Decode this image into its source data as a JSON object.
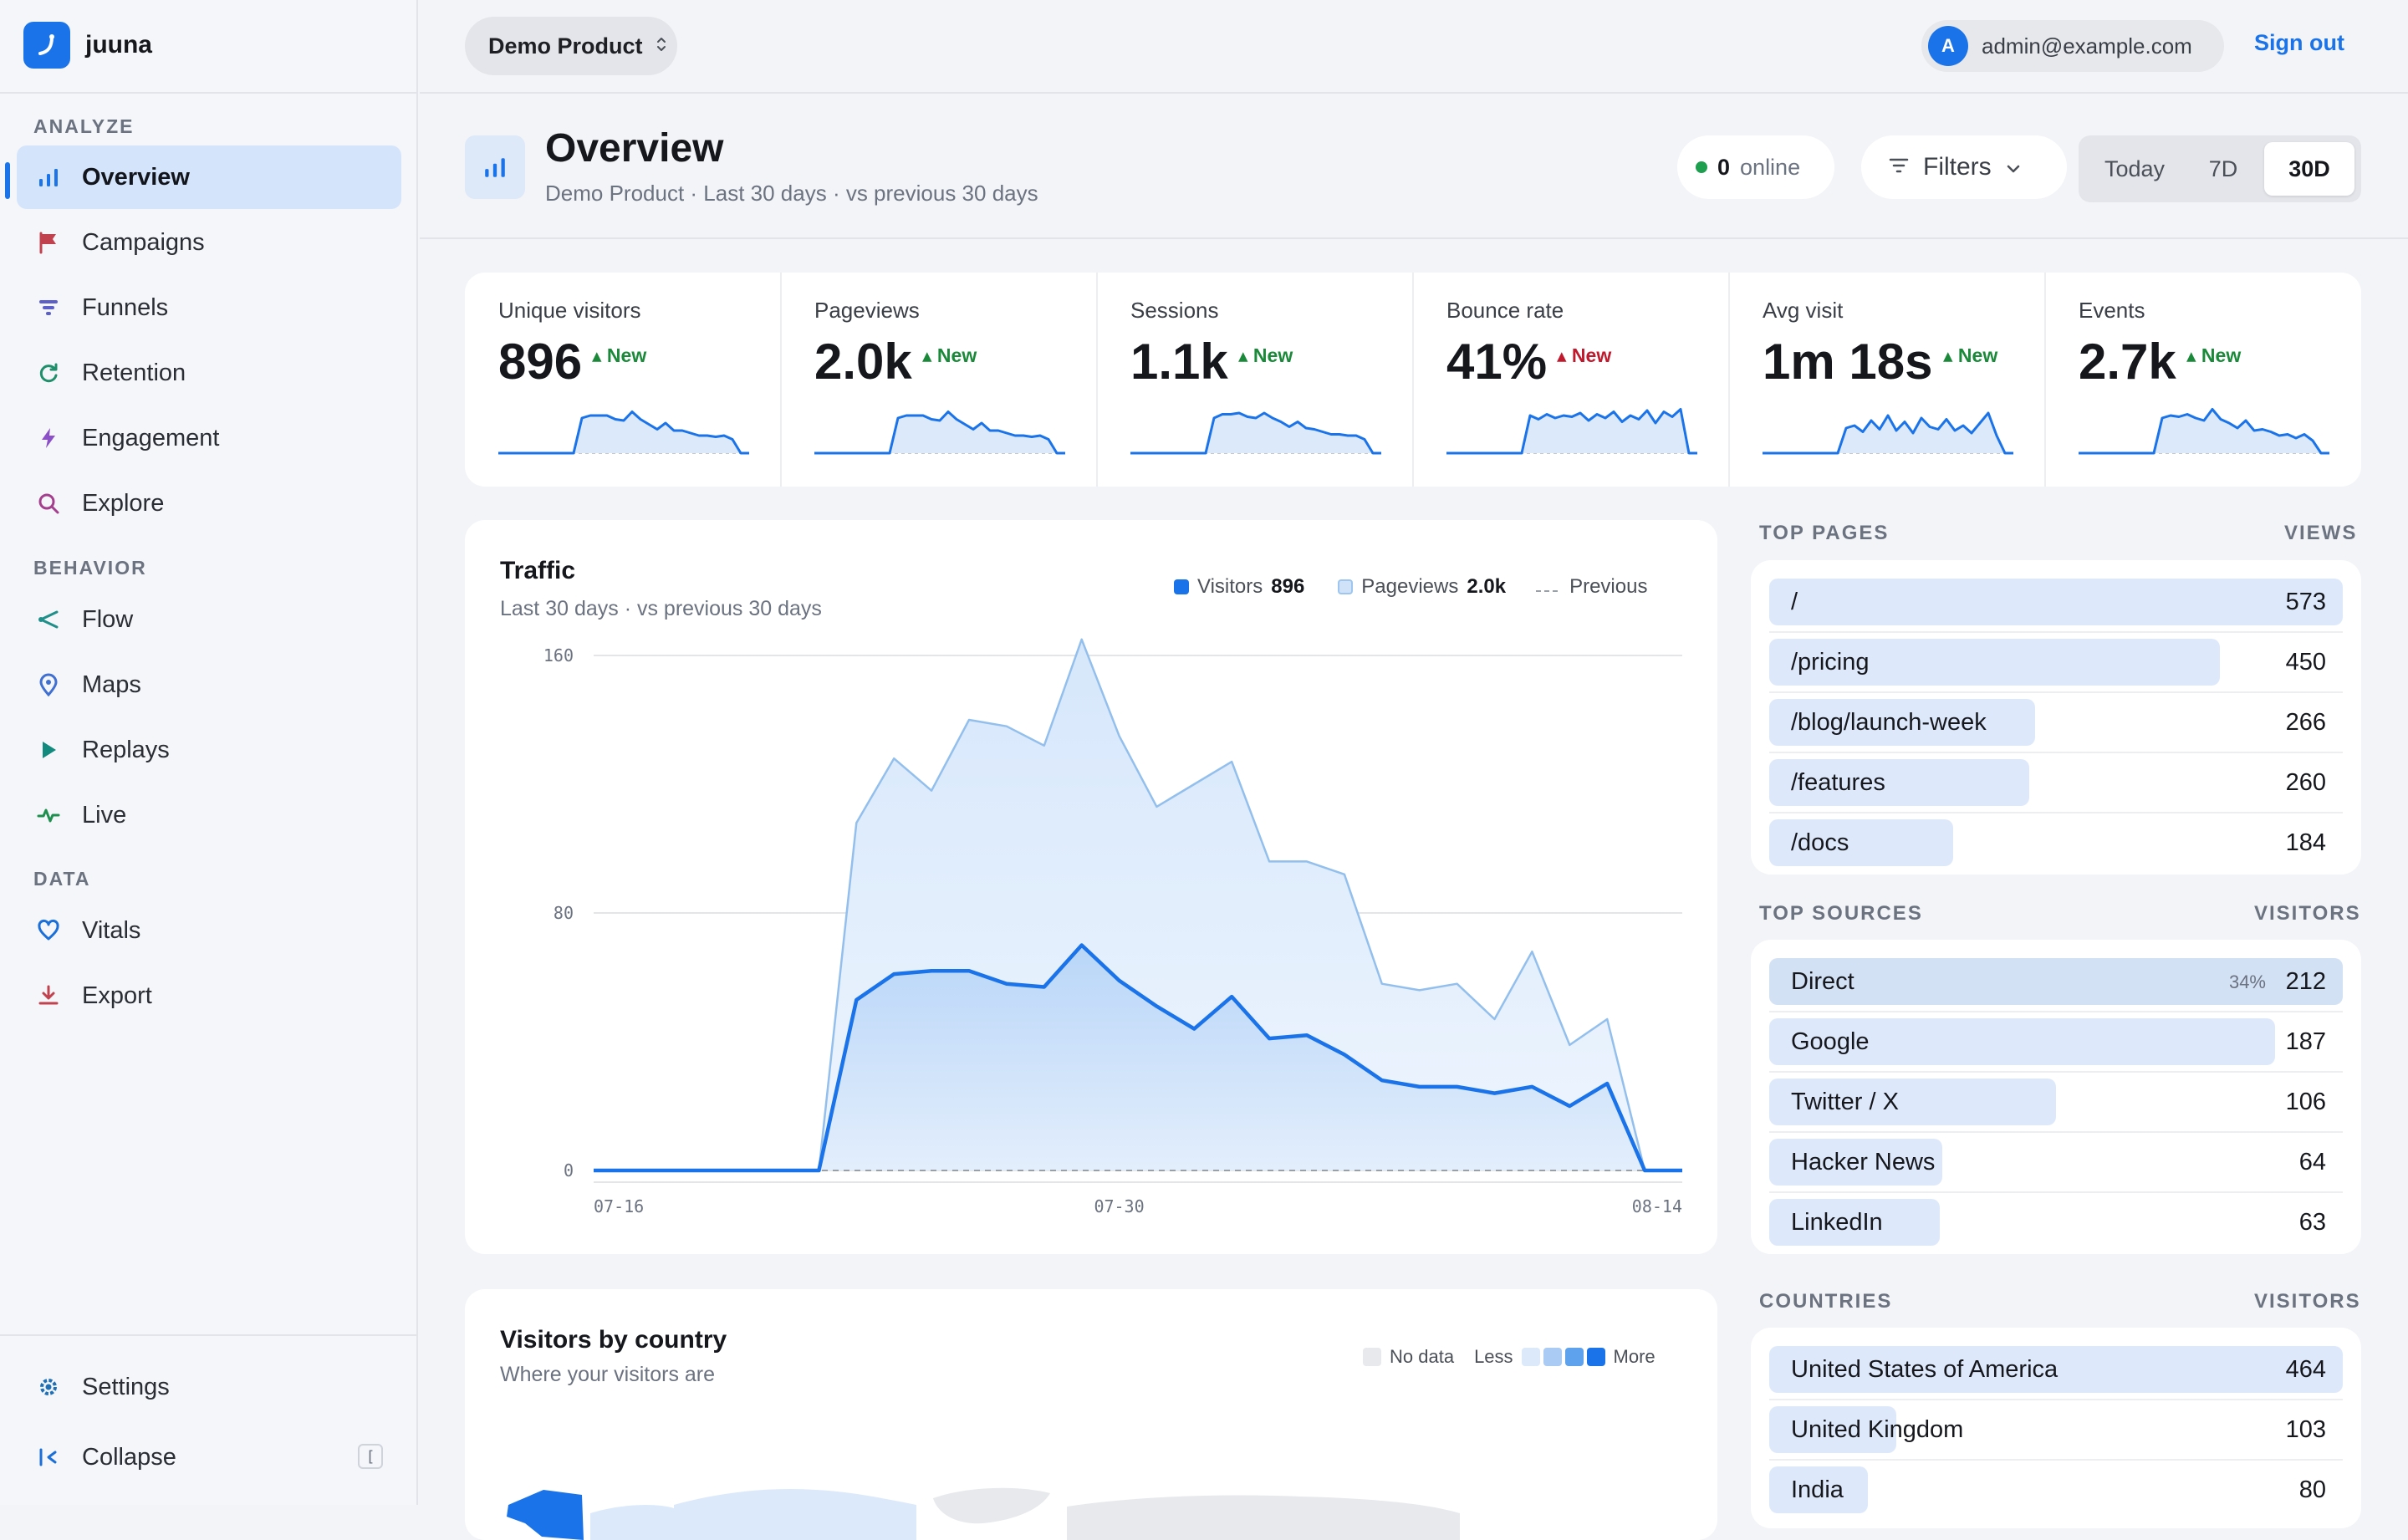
{
  "brand": {
    "name": "juuna"
  },
  "sidebar": {
    "sections": [
      {
        "label": "ANALYZE",
        "items": [
          {
            "label": "Overview",
            "icon": "bar-chart-icon",
            "active": true
          },
          {
            "label": "Campaigns",
            "icon": "flag-icon"
          },
          {
            "label": "Funnels",
            "icon": "funnel-icon"
          },
          {
            "label": "Retention",
            "icon": "refresh-icon"
          },
          {
            "label": "Engagement",
            "icon": "bolt-icon"
          },
          {
            "label": "Explore",
            "icon": "search-icon"
          }
        ]
      },
      {
        "label": "BEHAVIOR",
        "items": [
          {
            "label": "Flow",
            "icon": "share-icon"
          },
          {
            "label": "Maps",
            "icon": "map-pin-icon"
          },
          {
            "label": "Replays",
            "icon": "play-icon"
          },
          {
            "label": "Live",
            "icon": "pulse-icon"
          }
        ]
      },
      {
        "label": "DATA",
        "items": [
          {
            "label": "Vitals",
            "icon": "heart-icon"
          },
          {
            "label": "Export",
            "icon": "download-icon"
          }
        ]
      }
    ],
    "settings_label": "Settings",
    "collapse_label": "Collapse",
    "collapse_shortcut": "["
  },
  "topbar": {
    "product": "Demo Product",
    "user_initial": "A",
    "user_email": "admin@example.com",
    "signout": "Sign out"
  },
  "header": {
    "title": "Overview",
    "subtitle": "Demo Product · Last 30 days · vs previous 30 days",
    "online_count": "0",
    "online_label": "online",
    "filters_label": "Filters",
    "ranges": [
      "Today",
      "7D",
      "30D"
    ],
    "selected_range": "30D"
  },
  "kpis": [
    {
      "label": "Unique visitors",
      "value": "896",
      "badge": "New",
      "trend": "up",
      "spark": [
        0,
        0,
        0,
        0,
        0,
        0,
        0,
        0,
        0,
        0,
        28,
        30,
        30,
        30,
        27,
        26,
        33,
        27,
        23,
        19,
        24,
        18,
        18,
        16,
        14,
        14,
        13,
        14,
        11,
        0,
        0
      ]
    },
    {
      "label": "Pageviews",
      "value": "2.0k",
      "badge": "New",
      "trend": "up",
      "spark": [
        0,
        0,
        0,
        0,
        0,
        0,
        0,
        0,
        0,
        0,
        28,
        30,
        30,
        30,
        27,
        26,
        33,
        27,
        23,
        19,
        24,
        18,
        18,
        16,
        14,
        14,
        13,
        14,
        11,
        0,
        0
      ]
    },
    {
      "label": "Sessions",
      "value": "1.1k",
      "badge": "New",
      "trend": "up",
      "spark": [
        0,
        0,
        0,
        0,
        0,
        0,
        0,
        0,
        0,
        0,
        28,
        31,
        31,
        32,
        29,
        28,
        32,
        28,
        25,
        21,
        25,
        20,
        19,
        17,
        15,
        15,
        14,
        14,
        11,
        0,
        0
      ]
    },
    {
      "label": "Bounce rate",
      "value": "41%",
      "badge": "New",
      "trend": "down",
      "spark": [
        0,
        0,
        0,
        0,
        0,
        0,
        0,
        0,
        0,
        0,
        30,
        27,
        31,
        28,
        30,
        29,
        32,
        26,
        31,
        28,
        33,
        25,
        30,
        27,
        34,
        24,
        33,
        29,
        35,
        0,
        0
      ]
    },
    {
      "label": "Avg visit",
      "value": "1m 18s",
      "badge": "New",
      "trend": "up",
      "spark": [
        0,
        0,
        0,
        0,
        0,
        0,
        0,
        0,
        0,
        0,
        20,
        22,
        17,
        26,
        19,
        30,
        18,
        25,
        16,
        28,
        21,
        19,
        27,
        18,
        22,
        16,
        24,
        32,
        14,
        0,
        0
      ]
    },
    {
      "label": "Events",
      "value": "2.7k",
      "badge": "New",
      "trend": "up",
      "spark": [
        0,
        0,
        0,
        0,
        0,
        0,
        0,
        0,
        0,
        0,
        28,
        30,
        29,
        31,
        28,
        26,
        35,
        27,
        24,
        20,
        26,
        18,
        19,
        17,
        14,
        15,
        12,
        15,
        10,
        0,
        0
      ]
    }
  ],
  "traffic": {
    "title": "Traffic",
    "subtitle": "Last 30 days · vs previous 30 days",
    "legend": {
      "visitors_label": "Visitors",
      "visitors_total": "896",
      "pageviews_label": "Pageviews",
      "pageviews_total": "2.0k",
      "previous_label": "Previous"
    }
  },
  "chart_data": {
    "type": "area",
    "title": "Traffic",
    "x": [
      "07-16",
      "07-17",
      "07-18",
      "07-19",
      "07-20",
      "07-21",
      "07-22",
      "07-23",
      "07-24",
      "07-25",
      "07-26",
      "07-27",
      "07-28",
      "07-29",
      "07-30",
      "07-31",
      "08-01",
      "08-02",
      "08-03",
      "08-04",
      "08-05",
      "08-06",
      "08-07",
      "08-08",
      "08-09",
      "08-10",
      "08-11",
      "08-12",
      "08-13",
      "08-14"
    ],
    "x_tick_labels": [
      "07-16",
      "07-30",
      "08-14"
    ],
    "y_ticks": [
      0,
      80,
      160
    ],
    "ylim": [
      0,
      160
    ],
    "series": [
      {
        "name": "Visitors",
        "values": [
          0,
          0,
          0,
          0,
          0,
          0,
          0,
          53,
          61,
          62,
          62,
          58,
          57,
          70,
          59,
          51,
          44,
          54,
          41,
          42,
          36,
          28,
          26,
          26,
          24,
          26,
          20,
          27,
          0,
          0
        ]
      },
      {
        "name": "Pageviews",
        "values": [
          0,
          0,
          0,
          0,
          0,
          0,
          0,
          108,
          128,
          118,
          140,
          138,
          132,
          165,
          135,
          113,
          120,
          127,
          96,
          96,
          92,
          58,
          56,
          58,
          47,
          68,
          39,
          47,
          0,
          0
        ]
      },
      {
        "name": "Previous",
        "values": [
          0,
          0,
          0,
          0,
          0,
          0,
          0,
          0,
          0,
          0,
          0,
          0,
          0,
          0,
          0,
          0,
          0,
          0,
          0,
          0,
          0,
          0,
          0,
          0,
          0,
          0,
          0,
          0,
          0,
          0
        ]
      }
    ],
    "colors": {
      "Visitors": "#1a73e8",
      "Pageviews": "#9ec5ef",
      "Previous": "#9aa0a8"
    }
  },
  "top_pages": {
    "title": "TOP PAGES",
    "metric": "VIEWS",
    "rows": [
      {
        "label": "/",
        "value": "573",
        "share": 1.0
      },
      {
        "label": "/pricing",
        "value": "450",
        "share": 0.785
      },
      {
        "label": "/blog/launch-week",
        "value": "266",
        "share": 0.464
      },
      {
        "label": "/features",
        "value": "260",
        "share": 0.454
      },
      {
        "label": "/docs",
        "value": "184",
        "share": 0.321
      }
    ]
  },
  "top_sources": {
    "title": "TOP SOURCES",
    "metric": "VISITORS",
    "rows": [
      {
        "label": "Direct",
        "value": "212",
        "pct": "34%",
        "share": 1.0
      },
      {
        "label": "Google",
        "value": "187",
        "share": 0.882
      },
      {
        "label": "Twitter / X",
        "value": "106",
        "share": 0.5
      },
      {
        "label": "Hacker News",
        "value": "64",
        "share": 0.302
      },
      {
        "label": "LinkedIn",
        "value": "63",
        "share": 0.297
      }
    ]
  },
  "countries": {
    "title": "COUNTRIES",
    "metric": "VISITORS",
    "rows": [
      {
        "label": "United States of America",
        "value": "464",
        "share": 1.0
      },
      {
        "label": "United Kingdom",
        "value": "103",
        "share": 0.222
      },
      {
        "label": "India",
        "value": "80",
        "share": 0.172
      }
    ]
  },
  "map": {
    "title": "Visitors by country",
    "subtitle": "Where your visitors are",
    "legend_nodata": "No data",
    "legend_less": "Less",
    "legend_more": "More",
    "scale_colors": [
      "#dbe9fb",
      "#a9cbf4",
      "#5ea1ec",
      "#1a73e8"
    ]
  }
}
